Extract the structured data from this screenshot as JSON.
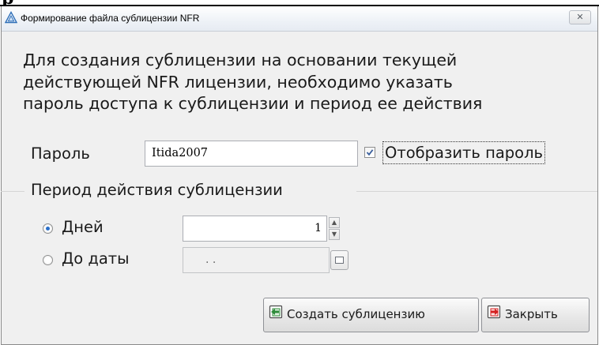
{
  "crop_fragment": {
    "letter": "р"
  },
  "window": {
    "title": "Формирование файла сублицензии NFR",
    "close_glyph": "✕"
  },
  "intro": {
    "lines": [
      "Для  создания  сублицензии  на  основании текущей",
      "действующей  NFR  лицензии, необходимо  указать",
      "пароль доступа к сублицензии и период ее действия"
    ]
  },
  "password": {
    "label": "Пароль",
    "value": "Itida2007",
    "show_password_label": "Отобразить пароль",
    "show_password_checked": true
  },
  "period": {
    "group_label": "Период действия сублицензии",
    "days_label": "Дней",
    "days_value": "1",
    "days_selected": true,
    "until_date_label": "До даты",
    "until_date_value": ". .",
    "until_date_selected": false
  },
  "buttons": {
    "create_label": "Создать сублицензию",
    "close_label": "Закрыть"
  },
  "icons": {
    "app": "triangle-app-icon",
    "close": "close-icon",
    "check": "checkmark-icon",
    "spin_up": "arrow-up-icon",
    "spin_down": "arrow-down-icon",
    "calendar": "calendar-icon",
    "create": "document-arrow-in-icon",
    "exit": "exit-arrow-icon"
  },
  "colors": {
    "window_bg": "#f0f0f0",
    "radio_accent": "#2a6fc9",
    "create_icon_green": "#2e8b3a",
    "close_icon_red": "#d42020"
  }
}
